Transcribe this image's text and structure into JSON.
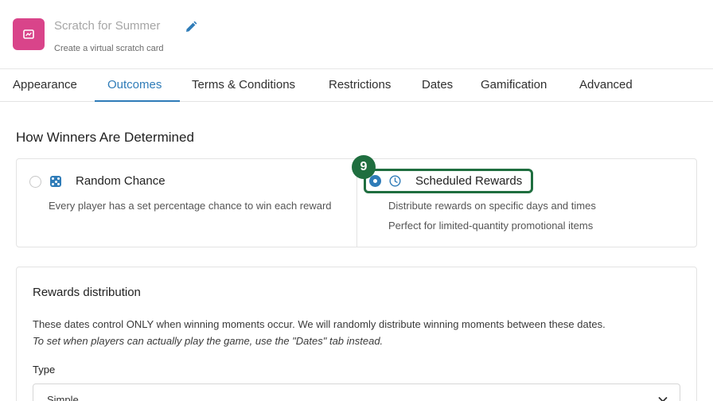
{
  "header": {
    "title": "Scratch for Summer",
    "subtitle": "Create a virtual scratch card",
    "icon": "scratch-card-icon",
    "icon_color": "#d9448a"
  },
  "tabs": [
    {
      "label": "Appearance",
      "active": false
    },
    {
      "label": "Outcomes",
      "active": true
    },
    {
      "label": "Terms & Conditions",
      "active": false
    },
    {
      "label": "Restrictions",
      "active": false
    },
    {
      "label": "Dates",
      "active": false
    },
    {
      "label": "Gamification",
      "active": false
    },
    {
      "label": "Advanced",
      "active": false
    }
  ],
  "accent_color": "#2f7cb8",
  "section_title": "How Winners Are Determined",
  "options": {
    "random": {
      "label": "Random Chance",
      "icon": "dice-icon",
      "selected": false,
      "description": "Every player has a set percentage chance to win each reward"
    },
    "scheduled": {
      "label": "Scheduled Rewards",
      "icon": "clock-icon",
      "selected": true,
      "description_line1": "Distribute rewards on specific days and times",
      "description_line2": "Perfect for limited-quantity promotional items"
    }
  },
  "annotation": {
    "badge": "9",
    "color": "#1f6e3f"
  },
  "rewards": {
    "title": "Rewards distribution",
    "info": "These dates control ONLY when winning moments occur. We will randomly distribute winning moments between these dates.",
    "info_italic": "To set when players can actually play the game, use the \"Dates\" tab instead.",
    "type_label": "Type",
    "type_value": "Simple"
  }
}
